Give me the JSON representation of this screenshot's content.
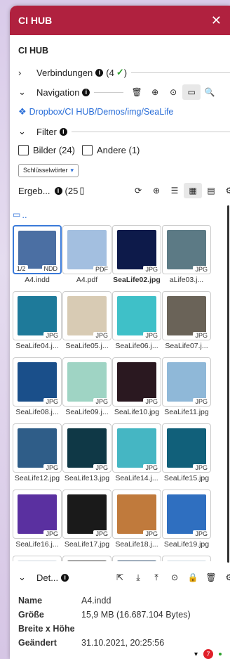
{
  "window": {
    "title": "CI HUB",
    "close_icon": "close-icon"
  },
  "section": {
    "title": "CI HUB",
    "menu_icon": "hamburger-icon"
  },
  "connections": {
    "label": "Verbindungen",
    "count": "(4",
    "count_close": ")"
  },
  "navigation": {
    "label": "Navigation"
  },
  "breadcrumb": {
    "root": "Dropbox",
    "sep": "/",
    "p1": "CI HUB",
    "p2": "Demos",
    "p3": "img",
    "p4": "SeaLife"
  },
  "filter": {
    "label": "Filter",
    "images": "Bilder (24)",
    "other": "Andere (1)"
  },
  "keyword": {
    "label": "Schlüsselwörter"
  },
  "results": {
    "label": "Ergeb...",
    "count": "(25"
  },
  "folder_up": "..",
  "tiles": [
    {
      "name": "A4.indd",
      "ext": "",
      "page": "1/2",
      "ndd": "NDD",
      "color": "#4b6fa3"
    },
    {
      "name": "A4.pdf",
      "ext": "PDF",
      "color": "#a3bfe0"
    },
    {
      "name": "SeaLife02.jpg",
      "ext": "JPG",
      "color": "#0d1a4a",
      "bold": true
    },
    {
      "name": "aLife03.j...",
      "ext": "JPG",
      "color": "#5c7a85"
    },
    {
      "name": "SeaLife04.j...",
      "ext": "JPG",
      "color": "#1e7a9a"
    },
    {
      "name": "SeaLife05.j...",
      "ext": "JPG",
      "color": "#d8cbb4"
    },
    {
      "name": "SeaLife06.j...",
      "ext": "JPG",
      "color": "#3fc0c8"
    },
    {
      "name": "SeaLife07.j...",
      "ext": "JPG",
      "color": "#6a6358"
    },
    {
      "name": "SeaLife08.j...",
      "ext": "JPG",
      "color": "#1a4f8a"
    },
    {
      "name": "SeaLife09.j...",
      "ext": "JPG",
      "color": "#9fd4c4"
    },
    {
      "name": "SeaLife10.jpg",
      "ext": "JPG",
      "color": "#2a1820"
    },
    {
      "name": "SeaLife11.jpg",
      "ext": "JPG",
      "color": "#8fb8d8"
    },
    {
      "name": "SeaLife12.jpg",
      "ext": "JPG",
      "color": "#2f5d88"
    },
    {
      "name": "SeaLife13.jpg",
      "ext": "JPG",
      "color": "#0f3846"
    },
    {
      "name": "SeaLife14.j...",
      "ext": "JPG",
      "color": "#45b6c3"
    },
    {
      "name": "SeaLife15.jpg",
      "ext": "JPG",
      "color": "#11607a"
    },
    {
      "name": "SeaLife16.j...",
      "ext": "JPG",
      "color": "#5a30a0"
    },
    {
      "name": "SeaLife17.jpg",
      "ext": "JPG",
      "color": "#1a1a1a"
    },
    {
      "name": "SeaLife18.j...",
      "ext": "JPG",
      "color": "#c07a3c"
    },
    {
      "name": "SeaLife19.jpg",
      "ext": "JPG",
      "color": "#2f6fc0"
    },
    {
      "name": "",
      "ext": "",
      "color": "#cfd7df"
    },
    {
      "name": "",
      "ext": "",
      "color": "#3a3a3a"
    },
    {
      "name": "",
      "ext": "",
      "color": "#2b4a6a"
    },
    {
      "name": "",
      "ext": "",
      "color": "#ccd8e0"
    }
  ],
  "details": {
    "label": "Det...",
    "name_k": "Name",
    "name_v": "A4.indd",
    "size_k": "Größe",
    "size_v": "15,9 MB (16.687.104 Bytes)",
    "dim_k": "Breite x Höhe",
    "dim_v": "",
    "mod_k": "Geändert",
    "mod_v": "31.10.2021, 20:25:56"
  },
  "badge_count": "7",
  "colors": {
    "accent": "#b0213f",
    "link": "#2a6ed8"
  }
}
